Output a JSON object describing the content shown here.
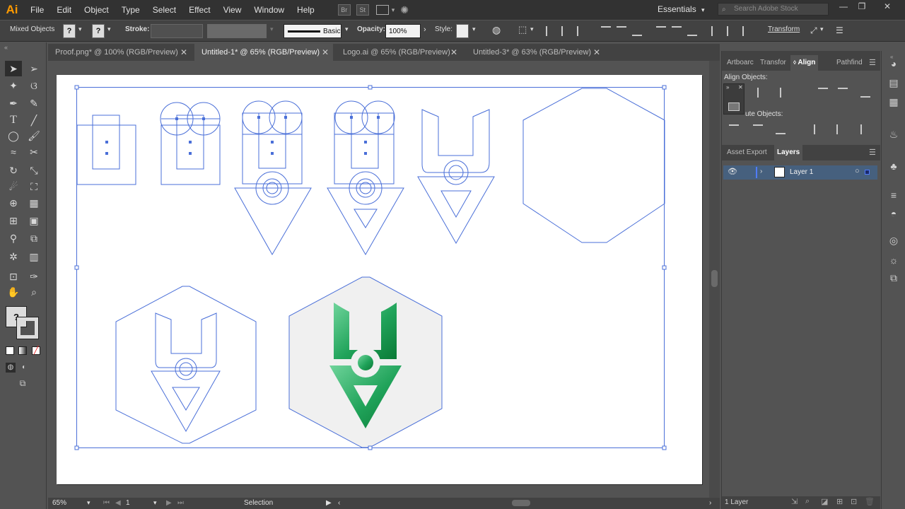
{
  "app": {
    "logo": "Ai"
  },
  "menu": [
    "File",
    "Edit",
    "Object",
    "Type",
    "Select",
    "Effect",
    "View",
    "Window",
    "Help"
  ],
  "menu_icons": [
    "Br",
    "St"
  ],
  "workspace": "Essentials",
  "search": {
    "placeholder": "Search Adobe Stock"
  },
  "control": {
    "selection_label": "Mixed Objects",
    "stroke_label": "Stroke:",
    "brush_label": "Basic",
    "opacity_label": "Opacity:",
    "opacity_value": "100%",
    "style_label": "Style:",
    "transform_label": "Transform"
  },
  "tabs": [
    {
      "label": "Proof.png* @ 100% (RGB/Preview)",
      "active": false
    },
    {
      "label": "Untitled-1* @ 65% (RGB/Preview)",
      "active": true
    },
    {
      "label": "Logo.ai @ 65% (RGB/Preview)",
      "active": false
    },
    {
      "label": "Untitled-3* @ 63% (RGB/Preview)",
      "active": false
    }
  ],
  "status": {
    "zoom": "65%",
    "artboard": "1",
    "tool": "Selection"
  },
  "panel_top": {
    "tabs": [
      "Artboarc",
      "Transfor",
      "Align",
      "Pathfind"
    ],
    "active": "Align",
    "align_objects_label": "Align Objects:",
    "distribute_objects_label": "ute Objects:"
  },
  "panel_bottom": {
    "tabs": [
      "Asset Export",
      "Layers"
    ],
    "active": "Layers",
    "layers": [
      {
        "name": "Layer 1"
      }
    ],
    "footer": "1 Layer"
  },
  "colors": {
    "selection": "#4a6fd8",
    "logo_green_light": "#5bc98a",
    "logo_green_dark": "#0e8a3e",
    "accent_orange": "#ff9a00"
  },
  "tool_icons": [
    "selection-tool-icon",
    "direct-selection-tool-icon",
    "magic-wand-icon",
    "lasso-icon",
    "pen-tool-icon",
    "curvature-tool-icon",
    "type-tool-icon",
    "line-tool-icon",
    "ellipse-tool-icon",
    "paintbrush-icon",
    "shaper-tool-icon",
    "scissors-icon",
    "rotate-tool-icon",
    "scale-tool-icon",
    "warp-tool-icon",
    "free-transform-icon",
    "shape-builder-icon",
    "perspective-grid-icon",
    "mesh-tool-icon",
    "gradient-tool-icon",
    "eyedropper-icon",
    "blend-tool-icon",
    "symbol-sprayer-icon",
    "column-graph-icon",
    "artboard-tool-icon",
    "slice-tool-icon",
    "hand-tool-icon",
    "zoom-tool-icon"
  ]
}
